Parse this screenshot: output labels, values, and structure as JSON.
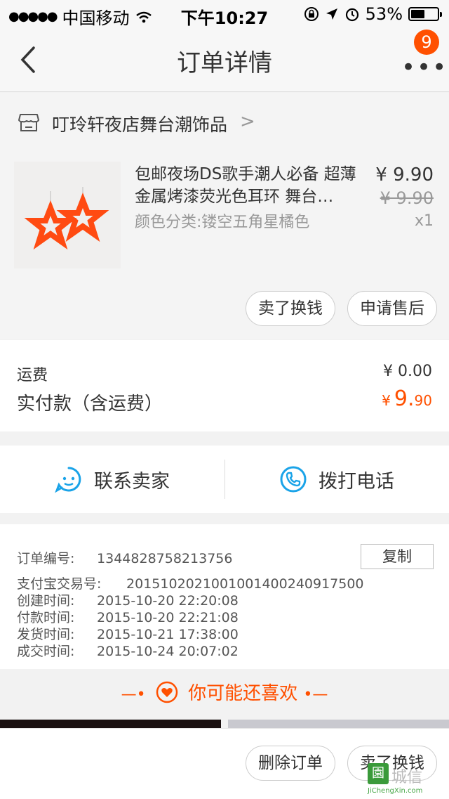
{
  "status_bar": {
    "carrier": "中国移动",
    "time": "下午10:27",
    "battery": "53%",
    "battery_level": 0.53
  },
  "nav": {
    "title": "订单详情",
    "badge": "9"
  },
  "shop": {
    "name": "叮玲轩夜店舞台潮饰品"
  },
  "product": {
    "title": "包邮夜场DS歌手潮人必备 超薄金属烤漆荧光色耳环 舞台…",
    "sku": "颜色分类:镂空五角星橘色",
    "price": "¥ 9.90",
    "original_price": "¥ 9.90",
    "quantity": "x1",
    "actions": [
      "卖了换钱",
      "申请售后"
    ]
  },
  "fees": {
    "shipping_label": "运费",
    "shipping_value": "¥ 0.00",
    "paid_label": "实付款（含运费）",
    "paid_currency": "¥",
    "paid_int": "9.",
    "paid_dec": "90"
  },
  "contact": {
    "seller": "联系卖家",
    "phone": "拨打电话"
  },
  "order_info": {
    "order_no_label": "订单编号:",
    "order_no": "1344828758213756",
    "copy_label": "复制",
    "alipay_label": "支付宝交易号:",
    "alipay_no": "2015102021001001400240917500",
    "created_label": "创建时间:",
    "created": "2015-10-20 22:20:08",
    "paid_label": "付款时间:",
    "paid": "2015-10-20 22:21:08",
    "shipped_label": "发货时间:",
    "shipped": "2015-10-21 17:38:00",
    "closed_label": "成交时间:",
    "closed": "2015-10-24 20:07:02"
  },
  "recommend": {
    "title": "你可能还喜欢"
  },
  "bottom_bar": {
    "delete_label": "删除订单",
    "sell_label": "卖了换钱"
  },
  "watermark": {
    "badge": "園",
    "text": "城信",
    "url": "JiChengXin.com"
  },
  "colors": {
    "accent": "#ff5000",
    "contact_icon": "#1aa3e8"
  }
}
